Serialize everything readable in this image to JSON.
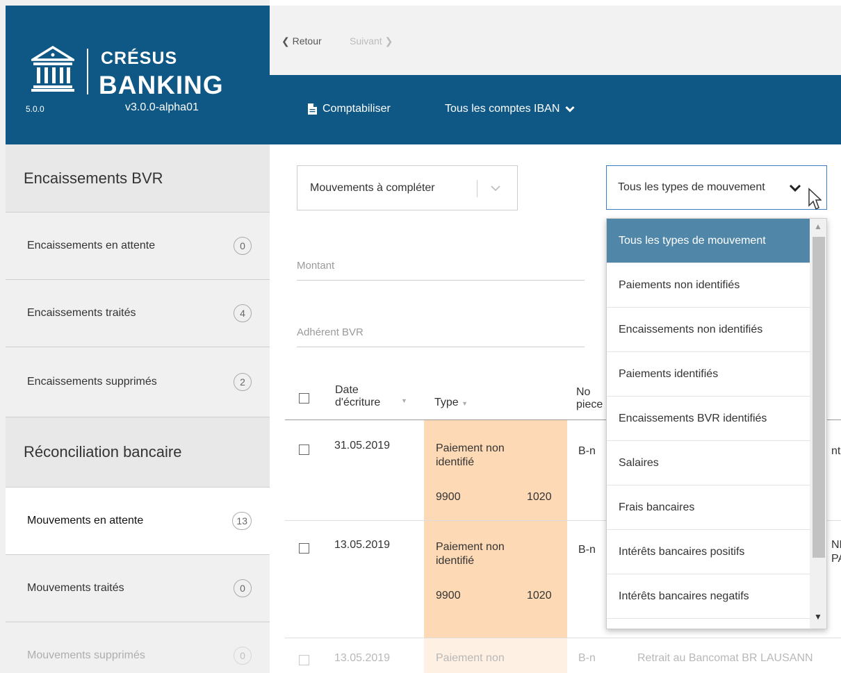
{
  "brand": {
    "name_line1": "CRÉSUS",
    "name_line2": "BANKING",
    "version_left": "5.0.0",
    "version_right": "v3.0.0-alpha01"
  },
  "nav": {
    "back_label": "Retour",
    "next_label": "Suivant"
  },
  "toolbar": {
    "comptabiliser_label": "Comptabiliser",
    "iban_label": "Tous les comptes IBAN"
  },
  "sidebar": {
    "section1_title": "Encaissements BVR",
    "section1_items": [
      {
        "label": "Encaissements en attente",
        "count": "0"
      },
      {
        "label": "Encaissements traités",
        "count": "4"
      },
      {
        "label": "Encaissements supprimés",
        "count": "2"
      }
    ],
    "section2_title": "Réconciliation bancaire",
    "section2_items": [
      {
        "label": "Mouvements en attente",
        "count": "13"
      },
      {
        "label": "Mouvements traités",
        "count": "0"
      },
      {
        "label": "Mouvements supprimés",
        "count": "0"
      }
    ]
  },
  "filters": {
    "status_value": "Mouvements à compléter",
    "type_value": "Tous les types de mouvement",
    "amount_placeholder": "Montant",
    "member_placeholder": "Adhérent BVR"
  },
  "table": {
    "headers": {
      "date_line1": "Date",
      "date_line2": "d'écriture",
      "type": "Type",
      "piece_line1": "No",
      "piece_line2": "piece"
    },
    "rows": [
      {
        "date": "31.05.2019",
        "type_line1": "Paiement non",
        "type_line2": "identifié",
        "debit": "9900",
        "credit": "1020",
        "piece": "B-n",
        "extra": "nt"
      },
      {
        "date": "13.05.2019",
        "type_line1": "Paiement non",
        "type_line2": "identifié",
        "debit": "9900",
        "credit": "1020",
        "piece": "B-n",
        "extra_line1": "NN",
        "extra_line2": "PAY"
      },
      {
        "date": "13.05.2019",
        "type_line1": "Paiement non",
        "piece": "B-n",
        "extra": "Retrait au Bancomat BR LAUSANN"
      }
    ]
  },
  "dropdown": {
    "options": [
      "Tous les types de mouvement",
      "Paiements non identifiés",
      "Encaissements non identifiés",
      "Paiements identifiés",
      "Encaissements BVR identifiés",
      "Salaires",
      "Frais bancaires",
      "Intérêts bancaires positifs",
      "Intérêts bancaires negatifs"
    ],
    "selected_index": 0
  },
  "colors": {
    "brand_blue": "#0f5885",
    "selected_option": "#5087a8",
    "type_highlight": "#fdd9b5"
  }
}
